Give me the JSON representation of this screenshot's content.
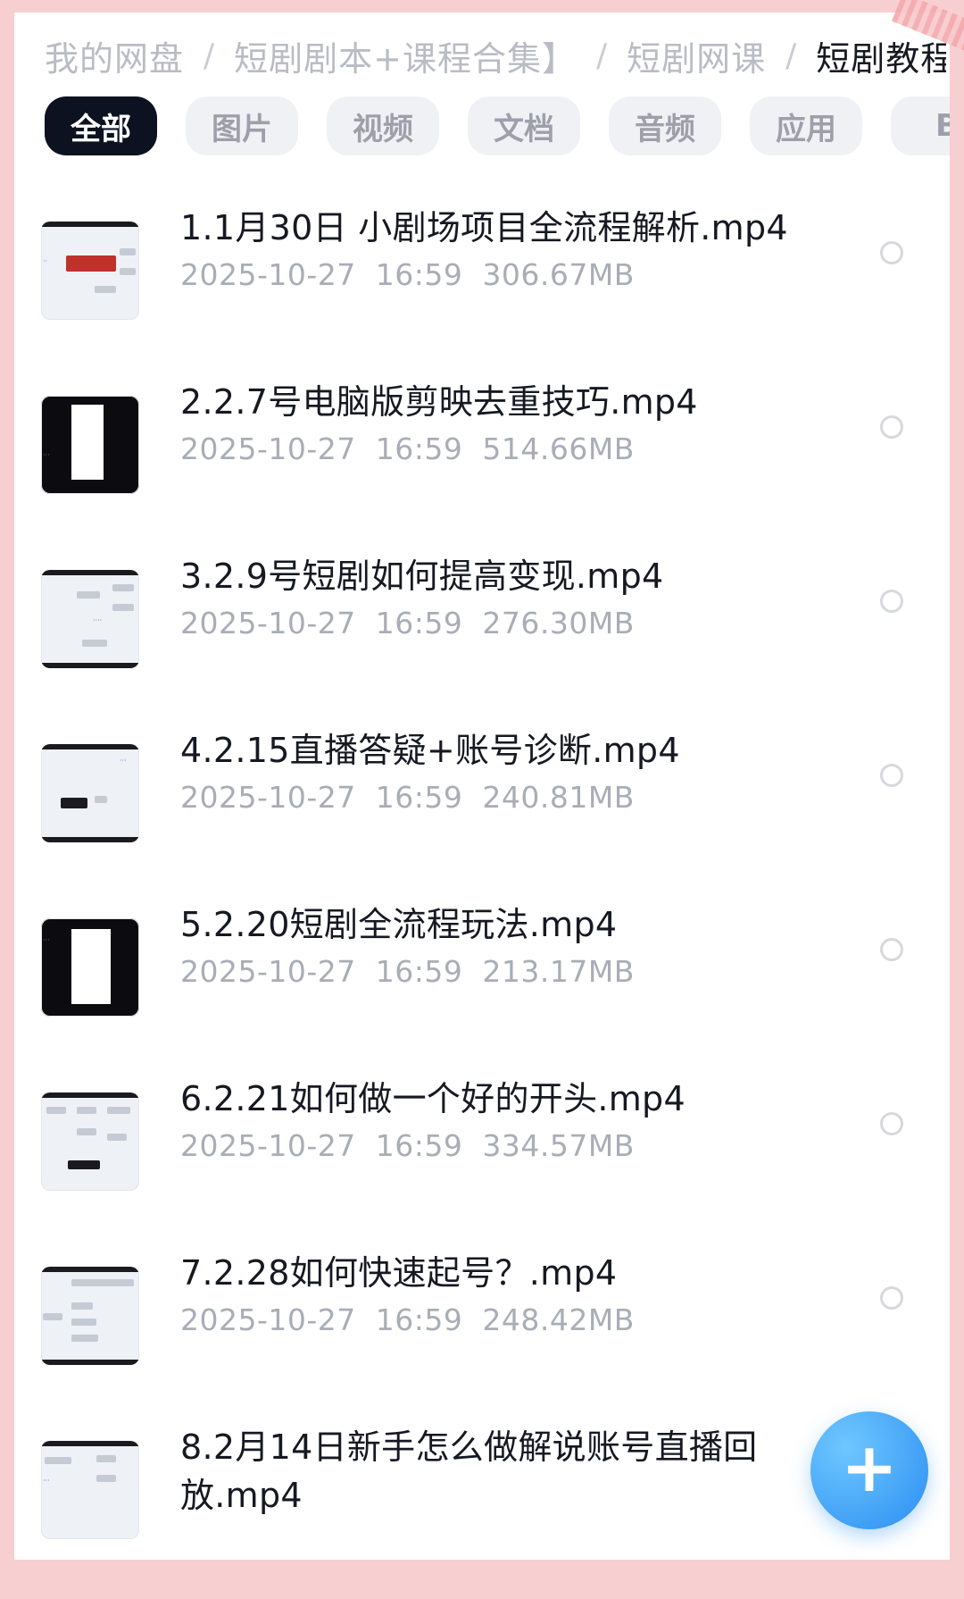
{
  "breadcrumb": {
    "items": [
      "我的网盘",
      "短剧剧本+课程合集】",
      "短剧网课"
    ],
    "separator": "/",
    "current": "短剧教程"
  },
  "tabs": {
    "items": [
      "全部",
      "图片",
      "视频",
      "文档",
      "音频",
      "应用",
      "B"
    ],
    "active_index": 0
  },
  "files": [
    {
      "name": "1.1月30日 小剧场项目全流程解析.mp4",
      "date": "2025-10-27",
      "time": "16:59",
      "size": "306.67MB"
    },
    {
      "name": "2.2.7号电脑版剪映去重技巧.mp4",
      "date": "2025-10-27",
      "time": "16:59",
      "size": "514.66MB"
    },
    {
      "name": "3.2.9号短剧如何提高变现.mp4",
      "date": "2025-10-27",
      "time": "16:59",
      "size": "276.30MB"
    },
    {
      "name": "4.2.15直播答疑+账号诊断.mp4",
      "date": "2025-10-27",
      "time": "16:59",
      "size": "240.81MB"
    },
    {
      "name": "5.2.20短剧全流程玩法.mp4",
      "date": "2025-10-27",
      "time": "16:59",
      "size": "213.17MB"
    },
    {
      "name": "6.2.21如何做一个好的开头.mp4",
      "date": "2025-10-27",
      "time": "16:59",
      "size": "334.57MB"
    },
    {
      "name": "7.2.28如何快速起号？.mp4",
      "date": "2025-10-27",
      "time": "16:59",
      "size": "248.42MB"
    },
    {
      "name": "8.2月14日新手怎么做解说账号直播回放.mp4",
      "date": "",
      "time": "",
      "size": ""
    }
  ],
  "fab": {
    "icon": "plus-icon",
    "label": "+"
  },
  "colors": {
    "accent": "#2b8ef2",
    "active_tab": "#0c1220",
    "frame": "#f7cfd0"
  }
}
